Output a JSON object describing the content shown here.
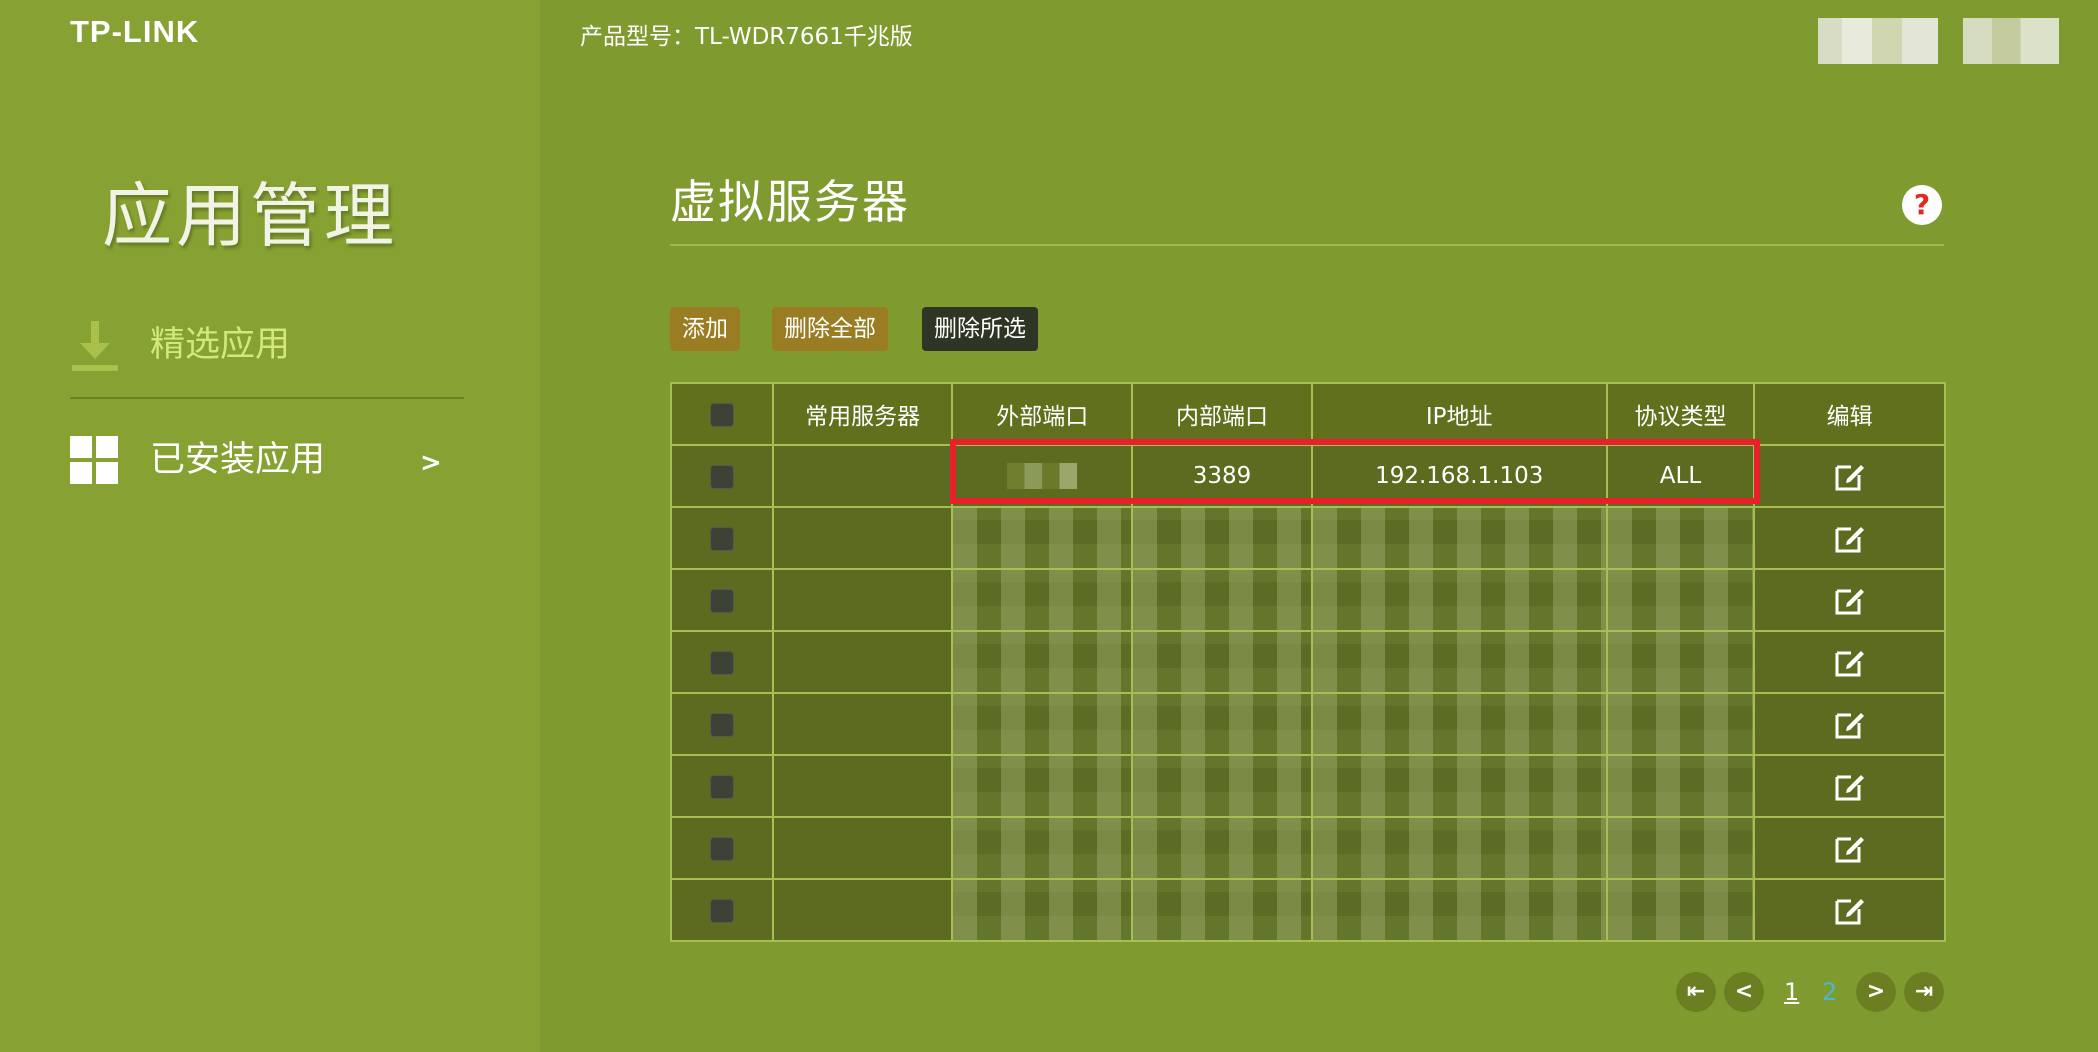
{
  "brand": "TP-LINK",
  "header": {
    "model_label": "产品型号：TL-WDR7661千兆版"
  },
  "sidebar": {
    "title": "应用管理",
    "items": [
      {
        "label": "精选应用"
      },
      {
        "label": "已安装应用",
        "arrow": ">"
      }
    ]
  },
  "main": {
    "title": "虚拟服务器",
    "help": "?",
    "buttons": {
      "add": "添加",
      "delete_all": "删除全部",
      "delete_selected": "删除所选"
    },
    "table": {
      "columns": [
        "常用服务器",
        "外部端口",
        "内部端口",
        "IP地址",
        "协议类型",
        "编辑"
      ],
      "rows": [
        {
          "service": "",
          "external_port": "",
          "internal_port": "3389",
          "ip": "192.168.1.103",
          "protocol": "ALL"
        }
      ],
      "obscured_row_count": 7
    },
    "pagination": {
      "pages": [
        "1",
        "2"
      ],
      "current": "1"
    }
  },
  "colors": {
    "sidebar": "#87a132",
    "main_bg": "#7f9a2f",
    "highlight": "#e8202a",
    "accent_button": "#9a7d22"
  }
}
